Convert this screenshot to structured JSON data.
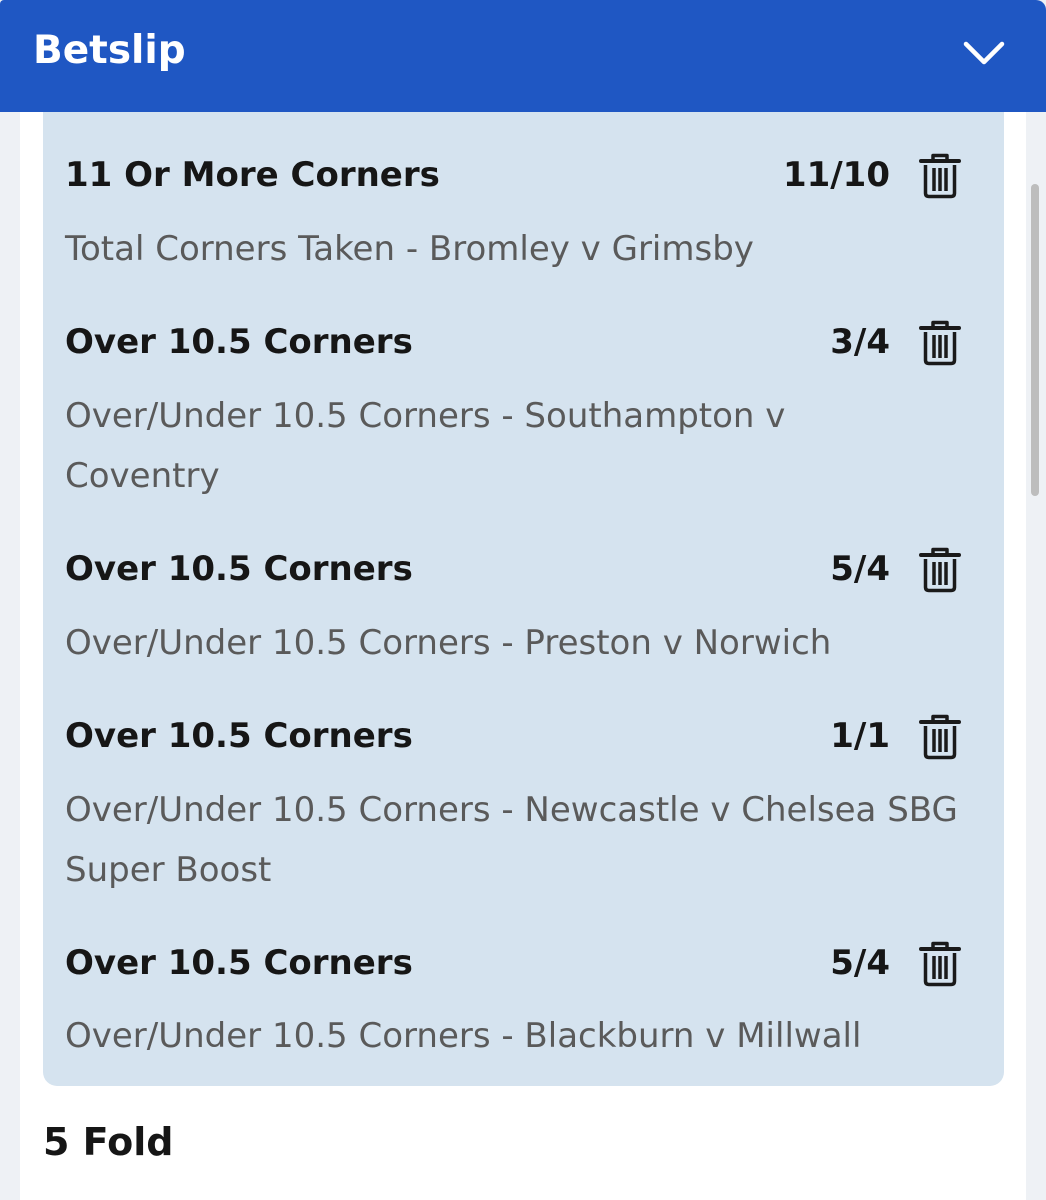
{
  "header": {
    "title": "Betslip",
    "collapse_icon": "chevron-down-icon",
    "background_color": "#1f57c3"
  },
  "selections": [
    {
      "title": "11 Or More Corners",
      "odds": "11/10",
      "description": "Total Corners Taken - Bromley v Grimsby",
      "remove_icon": "trash-icon"
    },
    {
      "title": "Over 10.5 Corners",
      "odds": "3/4",
      "description": "Over/Under 10.5 Corners - Southampton v Coventry",
      "remove_icon": "trash-icon"
    },
    {
      "title": "Over 10.5 Corners",
      "odds": "5/4",
      "description": "Over/Under 10.5 Corners - Preston v Norwich",
      "remove_icon": "trash-icon"
    },
    {
      "title": "Over 10.5 Corners",
      "odds": "1/1",
      "description": "Over/Under 10.5 Corners - Newcastle v Chelsea SBG Super Boost",
      "remove_icon": "trash-icon"
    },
    {
      "title": "Over 10.5 Corners",
      "odds": "5/4",
      "description": "Over/Under 10.5 Corners - Blackburn v Millwall",
      "remove_icon": "trash-icon"
    }
  ],
  "bet_type": {
    "label": "5 Fold"
  },
  "colors": {
    "selections_background": "#d5e3ef",
    "panel_background": "#ffffff",
    "text_primary": "#161616",
    "text_secondary": "#5a5a5a"
  }
}
